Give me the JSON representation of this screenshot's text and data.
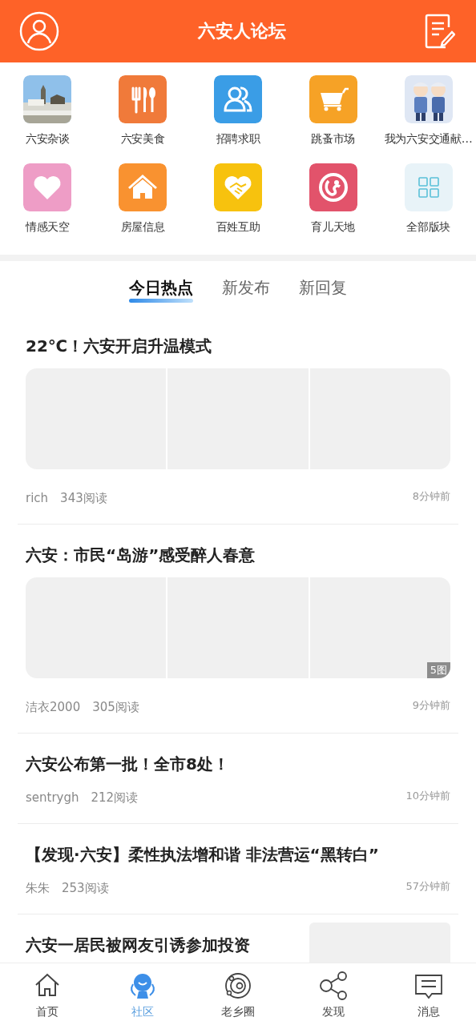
{
  "header": {
    "title": "六安人论坛"
  },
  "sections": [
    {
      "label": "六安杂谈"
    },
    {
      "label": "六安美食",
      "kind": "cutlery"
    },
    {
      "label": "招聘求职",
      "kind": "people"
    },
    {
      "label": "跳蚤市场",
      "kind": "cart"
    },
    {
      "label": "我为六安交通献…",
      "kind": "cartoon"
    },
    {
      "label": "情感天空",
      "kind": "heart"
    },
    {
      "label": "房屋信息",
      "kind": "house"
    },
    {
      "label": "百姓互助",
      "kind": "handshake"
    },
    {
      "label": "育儿天地",
      "kind": "mother"
    },
    {
      "label": "全部版块",
      "kind": "grid"
    }
  ],
  "tabs": [
    {
      "label": "今日热点",
      "selected": true
    },
    {
      "label": "新发布",
      "selected": false
    },
    {
      "label": "新回复",
      "selected": false
    }
  ],
  "posts": [
    {
      "kind": "gallery",
      "title": "22℃！六安开启升温模式",
      "author": "rich",
      "reads": "343阅读",
      "time": "8分钟前"
    },
    {
      "kind": "gallery",
      "title": "六安：市民“岛游”感受醉人春意",
      "badge": "5图",
      "author": "洁衣2000",
      "reads": "305阅读",
      "time": "9分钟前"
    },
    {
      "kind": "text",
      "title": "六安公布第一批！全市8处！",
      "author": "sentrygh",
      "reads": "212阅读",
      "time": "10分钟前"
    },
    {
      "kind": "text",
      "title": "【发现·六安】柔性执法增和谐 非法营运“黑转白”",
      "author": "朱朱",
      "reads": "253阅读",
      "time": "57分钟前"
    },
    {
      "kind": "thumb",
      "title": "六安一居民被网友引诱参加投资"
    }
  ],
  "nav": [
    {
      "label": "首页",
      "selected": false
    },
    {
      "label": "社区",
      "selected": true
    },
    {
      "label": "老乡圈",
      "selected": false
    },
    {
      "label": "发现",
      "selected": false
    },
    {
      "label": "消息",
      "selected": false
    }
  ]
}
